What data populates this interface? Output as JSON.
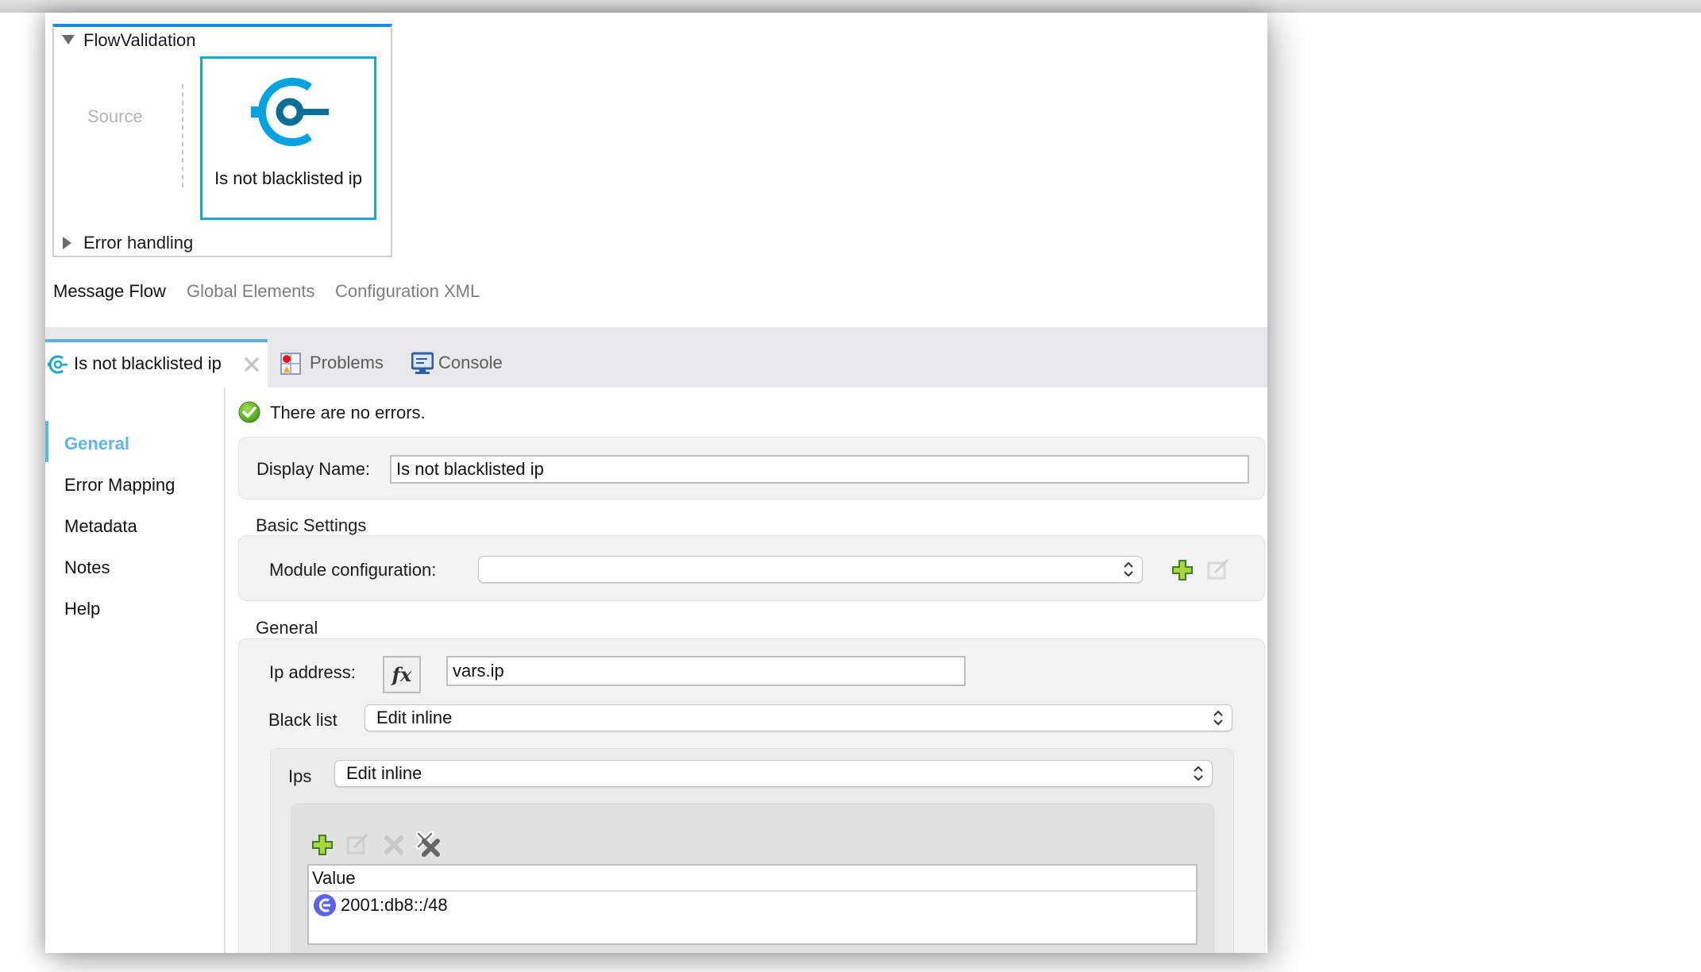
{
  "canvas": {
    "flow_name": "FlowValidation",
    "source_label": "Source",
    "component": {
      "label": "Is not blacklisted ip",
      "icon": "validation-connector-icon",
      "icon_colors": {
        "outer": "#00a2df",
        "inner": "#0a6e99"
      }
    },
    "error_handling_label": "Error handling"
  },
  "view_tabs": [
    {
      "label": "Message Flow",
      "active": true
    },
    {
      "label": "Global Elements",
      "active": false
    },
    {
      "label": "Configuration XML",
      "active": false
    }
  ],
  "bottom_tabs": [
    {
      "label": "Is not blacklisted ip",
      "icon": "validation-connector-icon",
      "active": true,
      "closable": true
    },
    {
      "label": "Problems",
      "icon": "problems-icon",
      "active": false
    },
    {
      "label": "Console",
      "icon": "console-icon",
      "active": false
    }
  ],
  "sidebar": {
    "items": [
      {
        "label": "General",
        "active": true
      },
      {
        "label": "Error Mapping",
        "active": false
      },
      {
        "label": "Metadata",
        "active": false
      },
      {
        "label": "Notes",
        "active": false
      },
      {
        "label": "Help",
        "active": false
      }
    ]
  },
  "status": {
    "icon": "check-circle-icon",
    "text": "There are no errors."
  },
  "form": {
    "display_name_label": "Display Name:",
    "display_name_value": "Is not blacklisted ip",
    "basic_settings_title": "Basic Settings",
    "module_config_label": "Module configuration:",
    "module_config_value": "",
    "general_title": "General",
    "ip_address_label": "Ip address:",
    "fx_label": "fx",
    "ip_address_value": "vars.ip",
    "black_list_label": "Black list",
    "black_list_value": "Edit inline",
    "ips_label": "Ips",
    "ips_value": "Edit inline",
    "table": {
      "columns": [
        "Value"
      ],
      "rows": [
        {
          "value": "2001:db8::/48",
          "icon": "expression-icon"
        }
      ]
    }
  },
  "colors": {
    "accent": "#5eb6e2",
    "flow_header": "#1f88e0",
    "component_border": "#19a9cf",
    "add_green": "#8cc63f"
  }
}
